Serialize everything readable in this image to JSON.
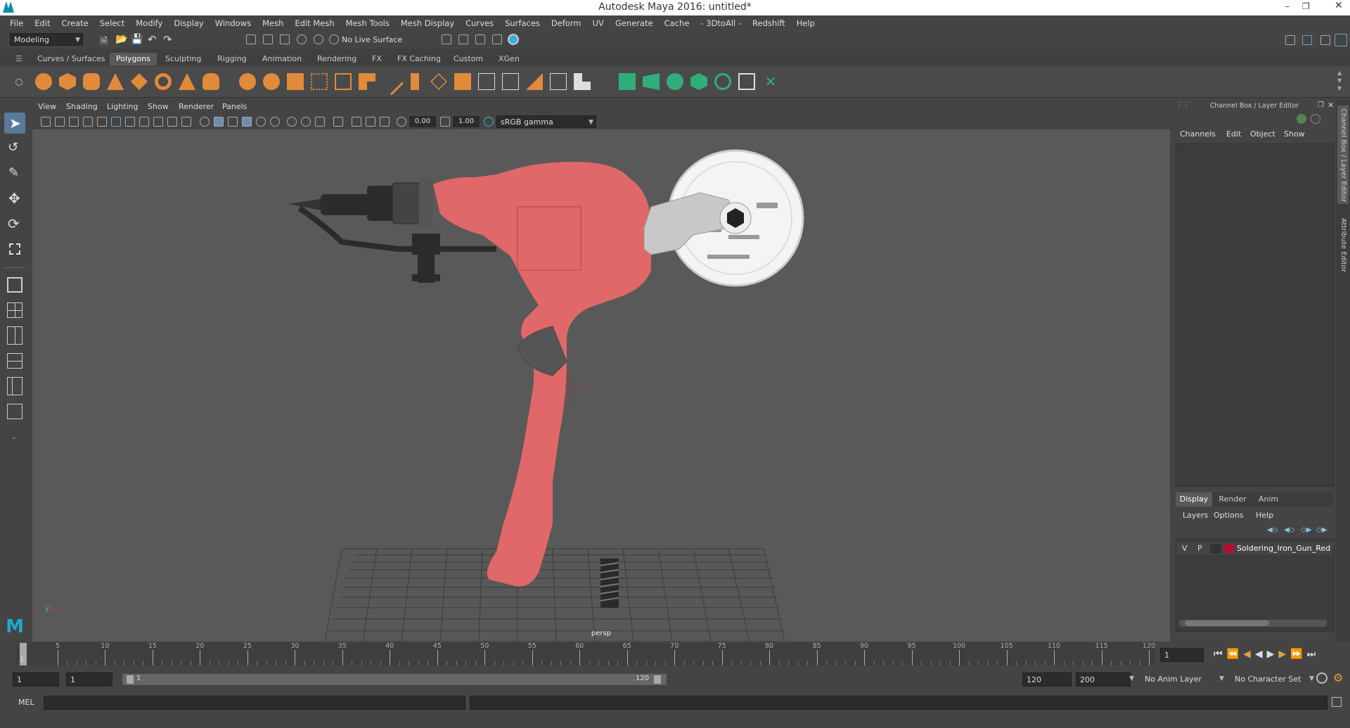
{
  "window": {
    "title": "Autodesk Maya 2016: untitled*"
  },
  "menubar": [
    "File",
    "Edit",
    "Create",
    "Select",
    "Modify",
    "Display",
    "Windows",
    "Mesh",
    "Edit Mesh",
    "Mesh Tools",
    "Mesh Display",
    "Curves",
    "Surfaces",
    "Deform",
    "UV",
    "Generate",
    "Cache",
    "- 3DtoAll -",
    "Redshift",
    "Help"
  ],
  "statusline": {
    "menuset": "Modeling",
    "live_surface": "No Live Surface"
  },
  "shelf": {
    "tabs": [
      "Curves / Surfaces",
      "Polygons",
      "Sculpting",
      "Rigging",
      "Animation",
      "Rendering",
      "FX",
      "FX Caching",
      "Custom",
      "XGen"
    ],
    "active_tab": "Polygons"
  },
  "panel_menu": [
    "View",
    "Shading",
    "Lighting",
    "Show",
    "Renderer",
    "Panels"
  ],
  "viewport_toolbar": {
    "exposure": "0.00",
    "gamma": "1.00",
    "color_space": "sRGB gamma"
  },
  "viewport": {
    "camera": "persp"
  },
  "channel_box": {
    "title": "Channel Box / Layer Editor",
    "menu": [
      "Channels",
      "Edit",
      "Object",
      "Show"
    ]
  },
  "layer_editor": {
    "tabs": [
      "Display",
      "Render",
      "Anim"
    ],
    "active_tab": "Display",
    "menu": [
      "Layers",
      "Options",
      "Help"
    ],
    "layers": [
      {
        "v": "V",
        "p": "P",
        "name": "Soldering_Iron_Gun_Red",
        "color": "#b01030"
      }
    ]
  },
  "side_tabs": [
    "Channel Box / Layer Editor",
    "Attribute Editor"
  ],
  "timeline": {
    "ticks": [
      "5",
      "10",
      "15",
      "20",
      "25",
      "30",
      "35",
      "40",
      "45",
      "50",
      "55",
      "60",
      "65",
      "70",
      "75",
      "80",
      "85",
      "90",
      "95",
      "100",
      "105",
      "110",
      "115",
      "120"
    ],
    "start_label": "1",
    "current_frame": "1"
  },
  "range": {
    "start": "1",
    "playback_start": "1",
    "slider_start": "1",
    "slider_end": "120",
    "playback_end": "120",
    "end": "200",
    "anim_layer": "No Anim Layer",
    "character_set": "No Character Set"
  },
  "command_line": {
    "label": "MEL"
  }
}
